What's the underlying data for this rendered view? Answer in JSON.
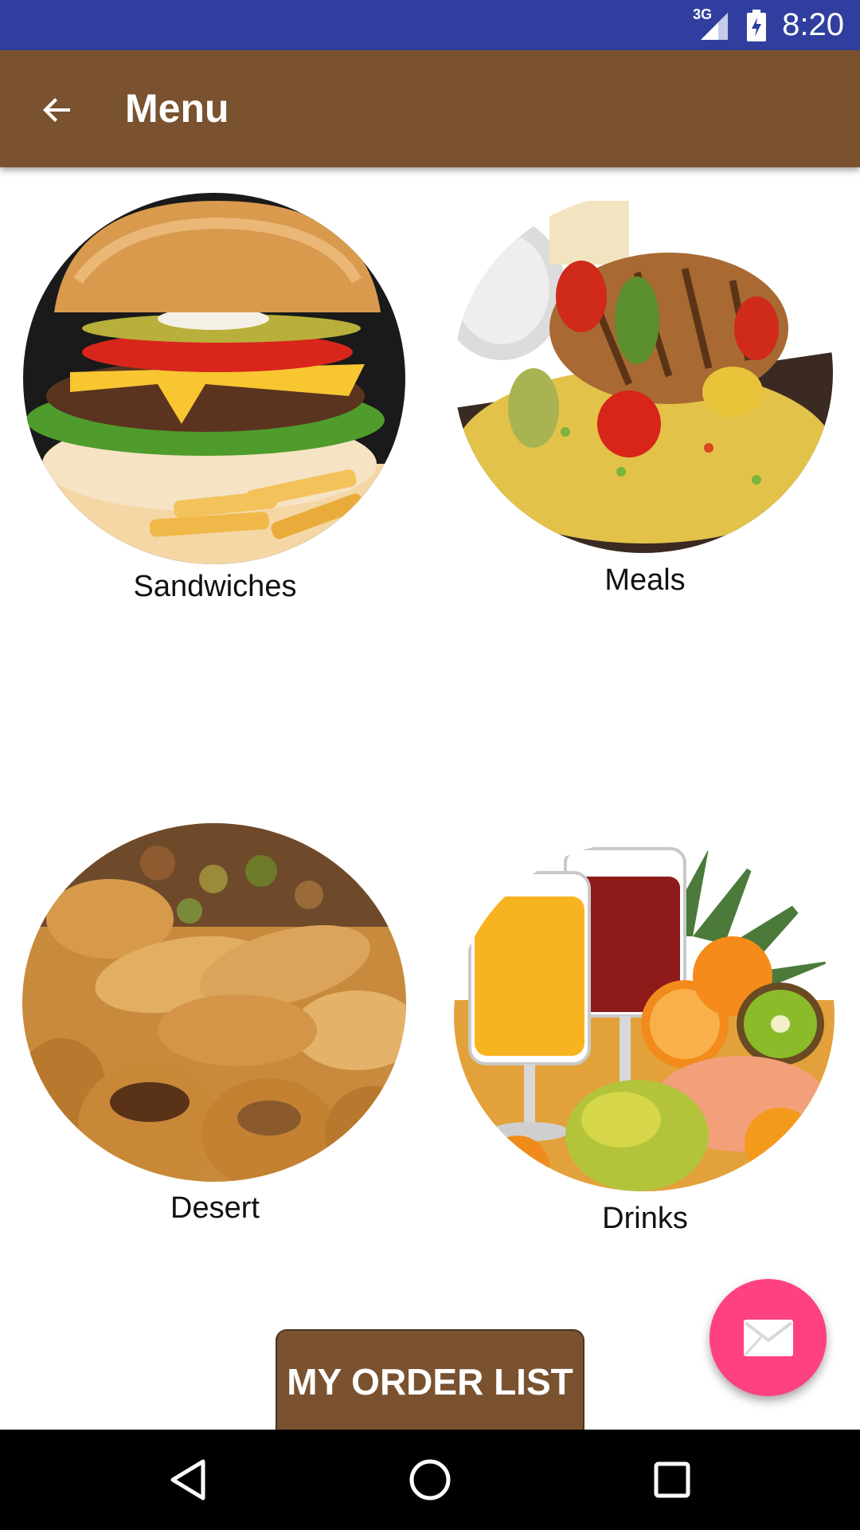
{
  "status_bar": {
    "time": "8:20",
    "network": "3G",
    "icons": [
      "signal-icon",
      "battery-icon"
    ]
  },
  "toolbar": {
    "title": "Menu",
    "back_icon": "arrow-back-icon"
  },
  "categories": [
    {
      "label": "Sandwiches",
      "image": "burger-photo"
    },
    {
      "label": "Meals",
      "image": "grilled-chicken-rice-photo"
    },
    {
      "label": "Desert",
      "image": "baklava-photo"
    },
    {
      "label": "Drinks",
      "image": "juice-and-fruits-photo"
    }
  ],
  "order_button": {
    "label": "MY ORDER LIST"
  },
  "fab": {
    "icon": "mail-icon",
    "color": "#FF4081"
  },
  "nav_bar": {
    "icons": [
      "nav-back-icon",
      "nav-home-icon",
      "nav-recents-icon"
    ]
  },
  "colors": {
    "status_bar": "#303F9F",
    "toolbar": "#7A5230",
    "accent": "#FF4081"
  }
}
